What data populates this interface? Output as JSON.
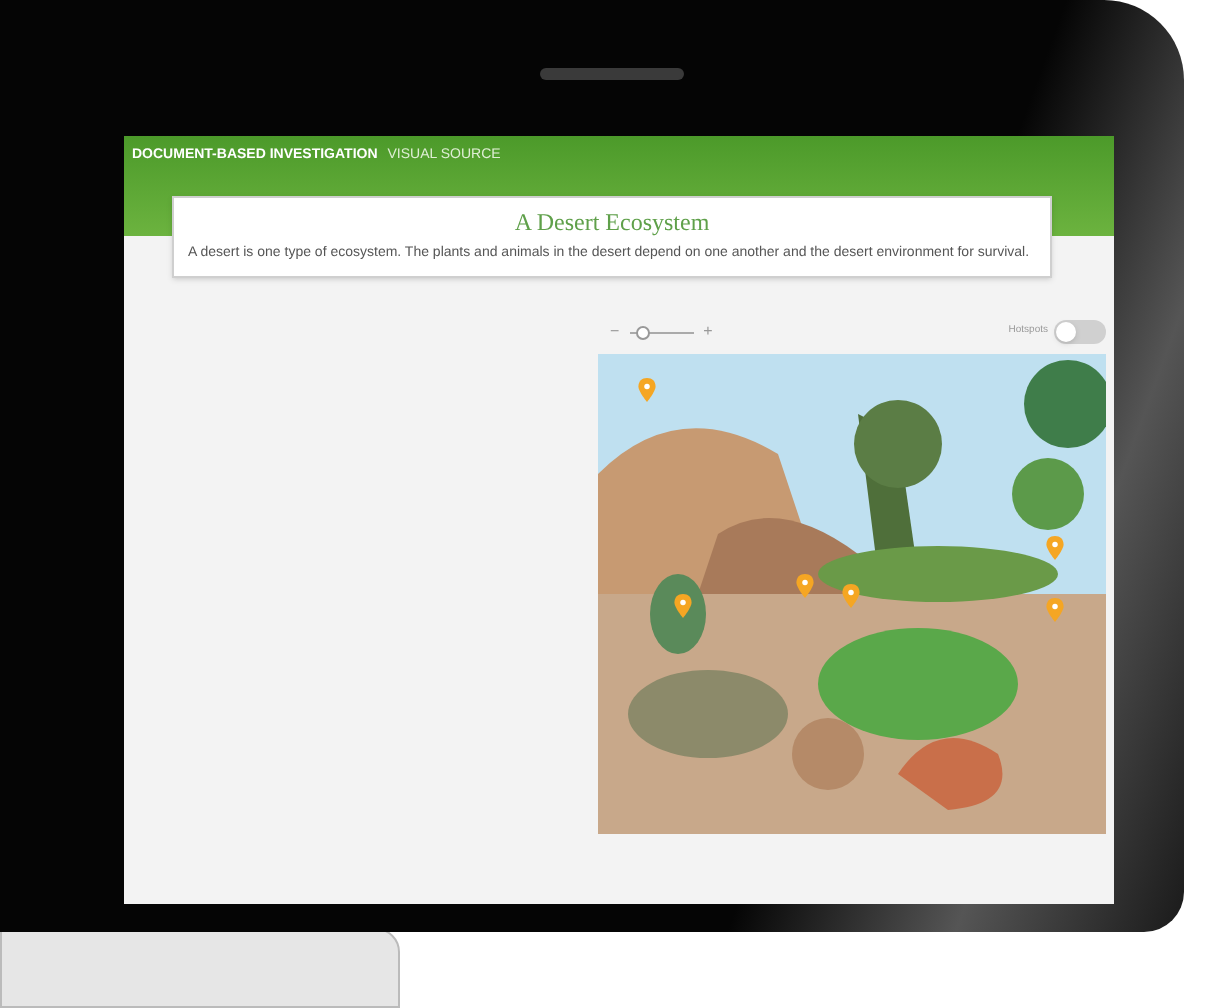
{
  "header": {
    "title": "DOCUMENT-BASED INVESTIGATION",
    "subtitle": "VISUAL SOURCE"
  },
  "card": {
    "title": "A Desert Ecosystem",
    "text": "A desert is one type of ecosystem. The plants and animals in the desert depend on one another and the desert environment for survival."
  },
  "zoom": {
    "minus": "−",
    "plus": "+",
    "level": 0.1
  },
  "hotspots": {
    "label": "Hotspots",
    "on": false
  }
}
